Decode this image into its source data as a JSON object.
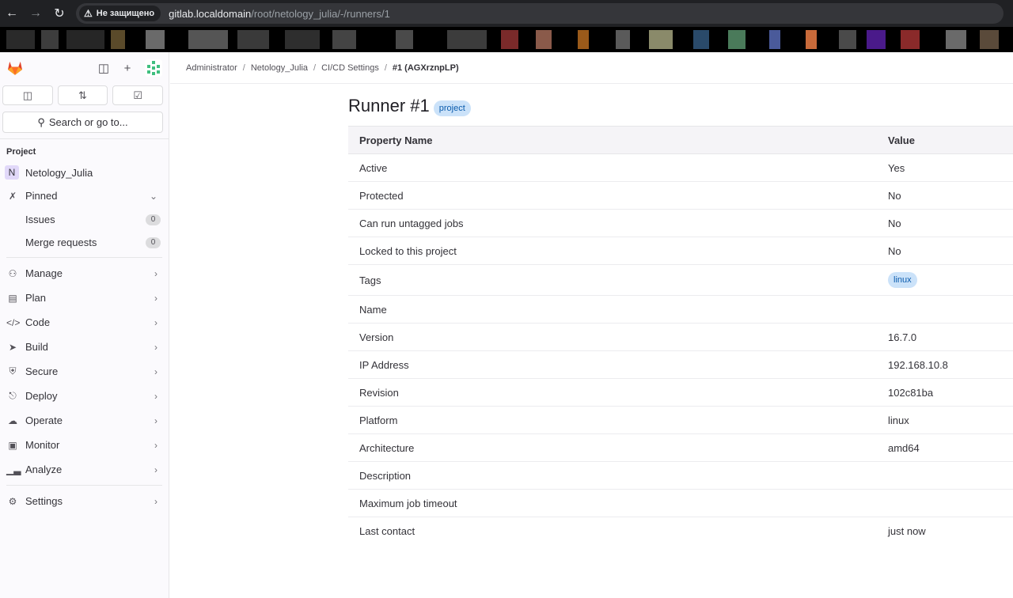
{
  "browser": {
    "security_label": "Не защищено",
    "url_host": "gitlab.localdomain",
    "url_path": "/root/netology_julia/-/runners/1"
  },
  "sidebar": {
    "search_label": "Search or go to...",
    "section_label": "Project",
    "project_initial": "N",
    "project_name": "Netology_Julia",
    "pinned_label": "Pinned",
    "pinned_items": [
      {
        "label": "Issues",
        "count": "0"
      },
      {
        "label": "Merge requests",
        "count": "0"
      }
    ],
    "nav_items": [
      {
        "label": "Manage",
        "icon": "users-icon"
      },
      {
        "label": "Plan",
        "icon": "planning-icon"
      },
      {
        "label": "Code",
        "icon": "code-icon"
      },
      {
        "label": "Build",
        "icon": "rocket-icon"
      },
      {
        "label": "Secure",
        "icon": "shield-icon"
      },
      {
        "label": "Deploy",
        "icon": "deployments-icon"
      },
      {
        "label": "Operate",
        "icon": "cloud-gear-icon"
      },
      {
        "label": "Monitor",
        "icon": "monitor-icon"
      },
      {
        "label": "Analyze",
        "icon": "chart-icon"
      }
    ],
    "settings_label": "Settings"
  },
  "breadcrumb": [
    "Administrator",
    "Netology_Julia",
    "CI/CD Settings",
    "#1 (AGXrznpLP)"
  ],
  "page": {
    "title": "Runner #1",
    "type_badge": "project"
  },
  "table": {
    "headers": [
      "Property Name",
      "Value"
    ],
    "rows": [
      {
        "name": "Active",
        "value": "Yes"
      },
      {
        "name": "Protected",
        "value": "No"
      },
      {
        "name": "Can run untagged jobs",
        "value": "No"
      },
      {
        "name": "Locked to this project",
        "value": "No"
      },
      {
        "name": "Tags",
        "value": "linux"
      },
      {
        "name": "Name",
        "value": ""
      },
      {
        "name": "Version",
        "value": "16.7.0"
      },
      {
        "name": "IP Address",
        "value": "192.168.10.8"
      },
      {
        "name": "Revision",
        "value": "102c81ba"
      },
      {
        "name": "Platform",
        "value": "linux"
      },
      {
        "name": "Architecture",
        "value": "amd64"
      },
      {
        "name": "Description",
        "value": ""
      },
      {
        "name": "Maximum job timeout",
        "value": ""
      },
      {
        "name": "Last contact",
        "value": "just now"
      }
    ]
  },
  "colors": {
    "brand_orange": "#e24329",
    "badge_bg": "#cbe2f9",
    "badge_text": "#0b5cad"
  }
}
